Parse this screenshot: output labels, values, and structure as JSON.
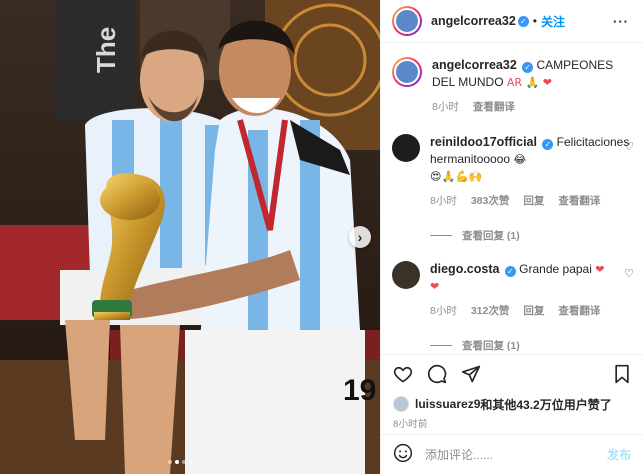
{
  "colors": {
    "accent": "#0095f6",
    "verified": "#3897f0",
    "heart": "#ed4956",
    "muted": "#8e8e8e"
  },
  "photo": {
    "slide_count": 4,
    "active_slide": 2,
    "next_icon": "chevron-right-icon"
  },
  "header": {
    "username": "angelcorrea32",
    "separator": "•",
    "follow_label": "关注",
    "more_label": "···"
  },
  "caption": {
    "username": "angelcorrea32",
    "text": "CAMPEONES DEL MUNDO",
    "emoji": "AR 🙏 ❤",
    "time": "8小时",
    "translate_label": "查看翻译"
  },
  "comments": [
    {
      "username": "reinildoo17official",
      "text": "Felicitaciones hermanitooooo",
      "emoji_inline": "😂",
      "emoji_line": "😍🙏💪🙌",
      "time": "8小时",
      "likes": "383次赞",
      "reply_label": "回复",
      "translate_label": "查看翻译",
      "view_replies": "查看回复 (1)"
    },
    {
      "username": "diego.costa",
      "text": "Grande papai",
      "emoji_inline": "❤",
      "emoji_line": "❤",
      "time": "8小时",
      "likes": "312次赞",
      "reply_label": "回复",
      "translate_label": "查看翻译",
      "view_replies": "查看回复 (1)"
    }
  ],
  "likes_line": {
    "user": "luissuarez9",
    "rest": "和其他43.2万位用户赞了"
  },
  "posted_time": "8小时前",
  "add_comment": {
    "placeholder": "添加评论......",
    "post_label": "发布"
  }
}
